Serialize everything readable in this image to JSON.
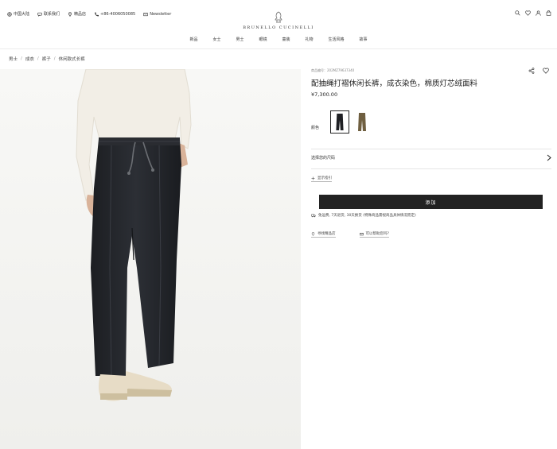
{
  "utility_bar": {
    "region": "中国大陆",
    "contact": "联系我们",
    "stores": "精品店",
    "phone": "+86-4006050085",
    "newsletter": "Newsletter"
  },
  "logo": {
    "text": "BRUNELLO CUCINELLI"
  },
  "nav": [
    "新品",
    "女士",
    "男士",
    "眼镜",
    "童装",
    "礼物",
    "生活风格",
    "故事"
  ],
  "breadcrumb": [
    "男士",
    "成衣",
    "裤子",
    "休闲款式长裤"
  ],
  "product": {
    "sku": "商品编号：202MZ79637340",
    "title": "配抽绳打褶休闲长裤，成衣染色，棉质灯芯绒面料",
    "price": "¥7,300.00",
    "color_label": "颜色",
    "size_label": "选择您的尺码",
    "size_guide": "显示指引",
    "add_button": "添加",
    "shipping": "免运费, 7天退货, 30天换货 (特殊商品需视商品具体情况而定)",
    "find_in_store": "寻找精品店",
    "need_help": "可以帮助您吗?"
  },
  "colors": {
    "swatch_selected": "#1f2024",
    "swatch_alt": "#6f5f40",
    "button_bg": "#222222"
  }
}
